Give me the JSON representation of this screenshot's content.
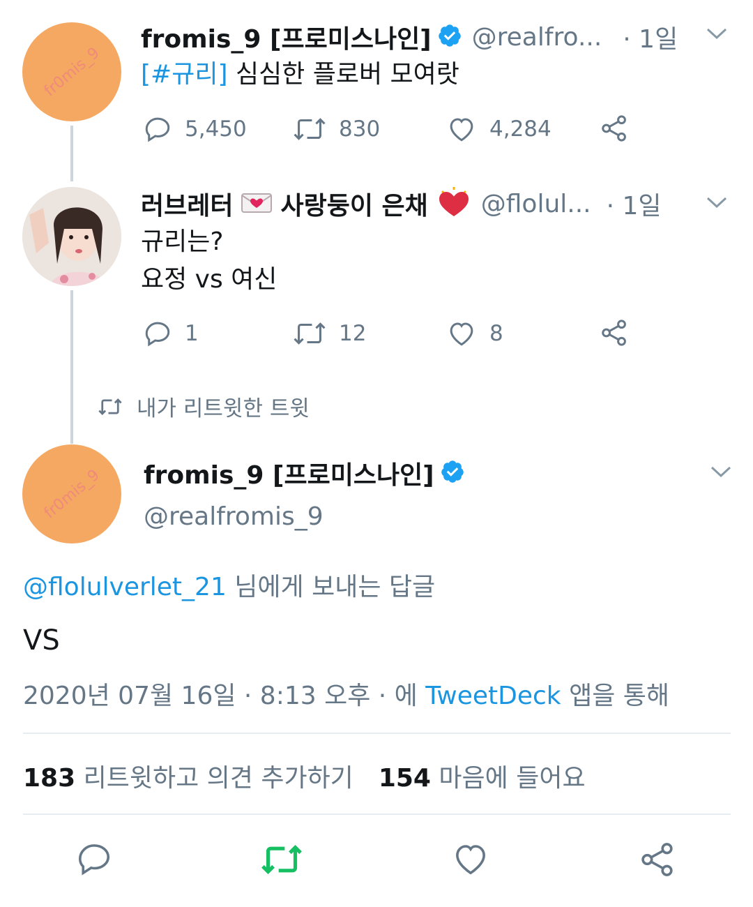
{
  "tweet1": {
    "avatar_text": "fr0mis_9",
    "name": "fromis_9 [프로미스나인]",
    "handle": "@realfro...",
    "time": "· 1일",
    "text_hashtag": "[#규리]",
    "text_rest": " 심심한 플로버 모여랏",
    "replies": "5,450",
    "retweets": "830",
    "likes": "4,284"
  },
  "tweet2": {
    "name_part1": "러브레터",
    "name_part2": "사랑둥이 은채",
    "handle": "@flolul...",
    "time": "· 1일",
    "line1": "규리는?",
    "line2": "요정 vs 여신",
    "replies": "1",
    "retweets": "12",
    "likes": "8"
  },
  "retweet_context": "내가 리트윗한 트윗",
  "main": {
    "avatar_text": "fr0mis_9",
    "name": "fromis_9 [프로미스나인]",
    "handle": "@realfromis_9",
    "reply_to_handle": "@flolulverlet_21",
    "reply_to_suffix": " 님에게 보내는 답글",
    "text": "VS",
    "date": "2020년 07월 16일 · 8:13 오후 · 에 ",
    "app": "TweetDeck",
    "app_suffix": " 앱을 통해",
    "retweet_count": "183",
    "retweet_label": " 리트윗하고 의견 추가하기",
    "like_count": "154",
    "like_label": " 마음에 들어요"
  },
  "colors": {
    "accent": "#1b95e0",
    "retweet_green": "#17bf63",
    "grey": "#657786",
    "avatar_orange": "#f4a862",
    "heart_red": "#e0245e"
  },
  "icons": [
    "reply-icon",
    "retweet-icon",
    "like-icon",
    "share-icon",
    "chevron-down-icon",
    "verified-icon",
    "envelope-heart-emoji",
    "heart-emoji"
  ]
}
